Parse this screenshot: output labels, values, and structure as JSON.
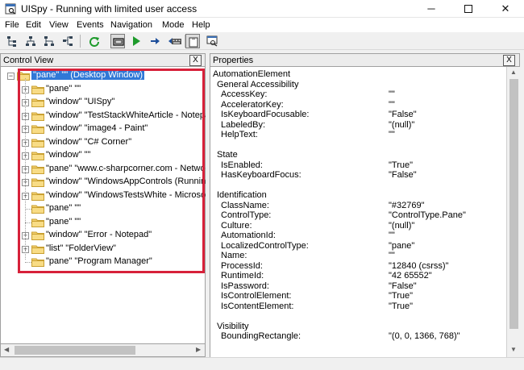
{
  "window": {
    "title": "UISpy - Running with limited user access",
    "minimize": "─",
    "close": "✕"
  },
  "menu": [
    "File",
    "Edit",
    "View",
    "Events",
    "Navigation",
    "Mode",
    "Help"
  ],
  "toolbar": {
    "icons": [
      "tree-nodes-icon",
      "tree-nodes-alt-icon",
      "tree-nodes-add-icon",
      "tree-nodes-expand-icon",
      "refresh-icon",
      "hover-mode-icon",
      "play-icon",
      "step-icon",
      "step-into-icon",
      "keyboard-icon",
      "clipboard-icon",
      "window-search-icon"
    ],
    "accent_green": "#1e9b2c"
  },
  "control_view": {
    "title": "Control View",
    "close_label": "X",
    "tree": [
      {
        "label": "\"pane\" \"\" (Desktop Window)",
        "selected": true,
        "level": 0,
        "expander": "−"
      },
      {
        "label": "\"pane\" \"\"",
        "level": 1,
        "expander": "+"
      },
      {
        "label": "\"window\" \"UISpy\"",
        "level": 1,
        "expander": "+"
      },
      {
        "label": "\"window\" \"TestStackWhiteArticle - Notepa",
        "level": 1,
        "expander": "+"
      },
      {
        "label": "\"window\" \"image4 - Paint\"",
        "level": 1,
        "expander": "+"
      },
      {
        "label": "\"window\" \"C# Corner\"",
        "level": 1,
        "expander": "+"
      },
      {
        "label": "\"window\" \"\"",
        "level": 1,
        "expander": "+"
      },
      {
        "label": "\"pane\" \"www.c-sharpcorner.com - Networ",
        "level": 1,
        "expander": "+"
      },
      {
        "label": "\"window\" \"WindowsAppControls (Running",
        "level": 1,
        "expander": "+"
      },
      {
        "label": "\"window\" \"WindowsTestsWhite - Microsof",
        "level": 1,
        "expander": "+"
      },
      {
        "label": "\"pane\" \"\"",
        "level": 1,
        "expander": ""
      },
      {
        "label": "\"pane\" \"\"",
        "level": 1,
        "expander": ""
      },
      {
        "label": "\"window\" \"Error - Notepad\"",
        "level": 1,
        "expander": "+"
      },
      {
        "label": "\"list\" \"FolderView\"",
        "level": 1,
        "expander": "+"
      },
      {
        "label": "\"pane\" \"Program Manager\"",
        "level": 1,
        "expander": ""
      }
    ],
    "highlight_color": "#d7213a"
  },
  "properties": {
    "title": "Properties",
    "close_label": "X",
    "rows": [
      {
        "label": "AutomationElement",
        "indent": 0
      },
      {
        "label": "General Accessibility",
        "indent": 1
      },
      {
        "label": "AccessKey:",
        "value": "\"\"",
        "indent": 2
      },
      {
        "label": "AcceleratorKey:",
        "value": "\"\"",
        "indent": 2
      },
      {
        "label": "IsKeyboardFocusable:",
        "value": "\"False\"",
        "indent": 2
      },
      {
        "label": "LabeledBy:",
        "value": "\"(null)\"",
        "indent": 2
      },
      {
        "label": "HelpText:",
        "value": "\"\"",
        "indent": 2
      },
      {
        "label": "",
        "indent": 0
      },
      {
        "label": "State",
        "indent": 1
      },
      {
        "label": "IsEnabled:",
        "value": "\"True\"",
        "indent": 2
      },
      {
        "label": "HasKeyboardFocus:",
        "value": "\"False\"",
        "indent": 2
      },
      {
        "label": "",
        "indent": 0
      },
      {
        "label": "Identification",
        "indent": 1
      },
      {
        "label": "ClassName:",
        "value": "\"#32769\"",
        "indent": 2
      },
      {
        "label": "ControlType:",
        "value": "\"ControlType.Pane\"",
        "indent": 2
      },
      {
        "label": "Culture:",
        "value": "\"(null)\"",
        "indent": 2
      },
      {
        "label": "AutomationId:",
        "value": "\"\"",
        "indent": 2
      },
      {
        "label": "LocalizedControlType:",
        "value": "\"pane\"",
        "indent": 2
      },
      {
        "label": "Name:",
        "value": "\"\"",
        "indent": 2
      },
      {
        "label": "ProcessId:",
        "value": "\"12840 (csrss)\"",
        "indent": 2
      },
      {
        "label": "RuntimeId:",
        "value": "\"42 65552\"",
        "indent": 2
      },
      {
        "label": "IsPassword:",
        "value": "\"False\"",
        "indent": 2
      },
      {
        "label": "IsControlElement:",
        "value": "\"True\"",
        "indent": 2
      },
      {
        "label": "IsContentElement:",
        "value": "\"True\"",
        "indent": 2
      },
      {
        "label": "",
        "indent": 0
      },
      {
        "label": "Visibility",
        "indent": 1
      },
      {
        "label": "BoundingRectangle:",
        "value": "\"(0, 0, 1366, 768)\"",
        "indent": 2
      }
    ]
  }
}
